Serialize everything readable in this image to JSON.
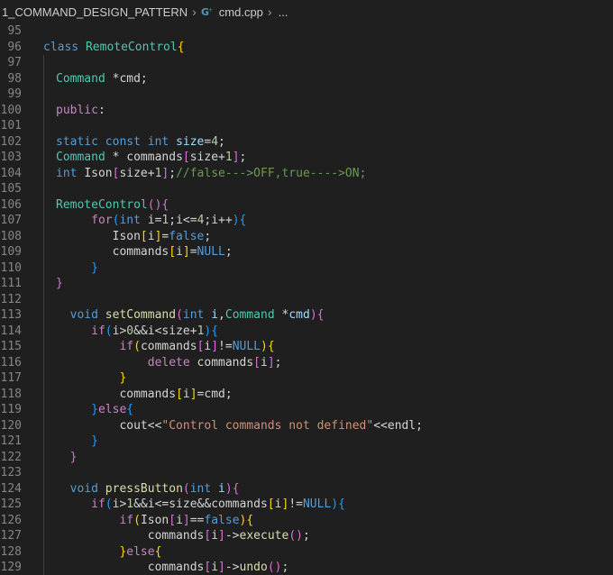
{
  "breadcrumb": {
    "folder": "1_COMMAND_DESIGN_PATTERN",
    "file": "cmd.cpp",
    "more": "..."
  },
  "editor": {
    "language": "cpp",
    "theme_colors": {
      "background": "#1f1f1f",
      "line_number": "#858585",
      "keyword": "#569cd6",
      "control": "#c586c0",
      "type": "#4ec9b0",
      "function": "#dcdcaa",
      "variable": "#9cdcfe",
      "number": "#b5cea8",
      "string": "#ce9178",
      "comment": "#6a9955"
    },
    "lines": [
      {
        "n": "95",
        "indent": 0,
        "tokens": []
      },
      {
        "n": "96",
        "indent": 0,
        "tokens": [
          [
            "k",
            "class "
          ],
          [
            "t",
            "RemoteControl"
          ],
          [
            "b1",
            "{"
          ]
        ]
      },
      {
        "n": "97",
        "indent": 1,
        "tokens": []
      },
      {
        "n": "98",
        "indent": 1,
        "tokens": [
          [
            "t",
            "Command"
          ],
          [
            "p",
            " *cmd;"
          ]
        ]
      },
      {
        "n": "99",
        "indent": 1,
        "tokens": []
      },
      {
        "n": "100",
        "indent": 1,
        "tokens": [
          [
            "c",
            "public"
          ],
          [
            "p",
            ":"
          ]
        ]
      },
      {
        "n": "101",
        "indent": 1,
        "tokens": []
      },
      {
        "n": "102",
        "indent": 1,
        "tokens": [
          [
            "k",
            "static "
          ],
          [
            "k",
            "const "
          ],
          [
            "k",
            "int "
          ],
          [
            "v",
            "size"
          ],
          [
            "p",
            "="
          ],
          [
            "n",
            "4"
          ],
          [
            "p",
            ";"
          ]
        ]
      },
      {
        "n": "103",
        "indent": 1,
        "tokens": [
          [
            "t",
            "Command"
          ],
          [
            "p",
            " * commands"
          ],
          [
            "b2",
            "["
          ],
          [
            "p",
            "size+"
          ],
          [
            "n",
            "1"
          ],
          [
            "b2",
            "]"
          ],
          [
            "p",
            ";"
          ]
        ]
      },
      {
        "n": "104",
        "indent": 1,
        "tokens": [
          [
            "k",
            "int "
          ],
          [
            "p",
            "Ison"
          ],
          [
            "b2",
            "["
          ],
          [
            "p",
            "size+"
          ],
          [
            "n",
            "1"
          ],
          [
            "b2",
            "]"
          ],
          [
            "p",
            ";"
          ],
          [
            "cm",
            "//false--->OFF,true---->ON;"
          ]
        ]
      },
      {
        "n": "105",
        "indent": 1,
        "tokens": []
      },
      {
        "n": "106",
        "indent": 1,
        "tokens": [
          [
            "t",
            "RemoteControl"
          ],
          [
            "b2",
            "()"
          ],
          [
            "b2",
            "{"
          ]
        ]
      },
      {
        "n": "107",
        "indent": 1,
        "tokens": [
          [
            "p",
            "     "
          ],
          [
            "c",
            "for"
          ],
          [
            "b3",
            "("
          ],
          [
            "k",
            "int "
          ],
          [
            "p",
            "i="
          ],
          [
            "n",
            "1"
          ],
          [
            "p",
            ";i<="
          ],
          [
            "n",
            "4"
          ],
          [
            "p",
            ";i++"
          ],
          [
            "b3",
            ")"
          ],
          [
            "b3",
            "{"
          ]
        ]
      },
      {
        "n": "108",
        "indent": 1,
        "tokens": [
          [
            "p",
            "        Ison"
          ],
          [
            "b1",
            "["
          ],
          [
            "p",
            "i"
          ],
          [
            "b1",
            "]"
          ],
          [
            "p",
            "="
          ],
          [
            "k",
            "false"
          ],
          [
            "p",
            ";"
          ]
        ]
      },
      {
        "n": "109",
        "indent": 1,
        "tokens": [
          [
            "p",
            "        commands"
          ],
          [
            "b1",
            "["
          ],
          [
            "p",
            "i"
          ],
          [
            "b1",
            "]"
          ],
          [
            "p",
            "="
          ],
          [
            "k",
            "NULL"
          ],
          [
            "p",
            ";"
          ]
        ]
      },
      {
        "n": "110",
        "indent": 1,
        "tokens": [
          [
            "p",
            "     "
          ],
          [
            "b3",
            "}"
          ]
        ]
      },
      {
        "n": "111",
        "indent": 1,
        "tokens": [
          [
            "b2",
            "}"
          ]
        ]
      },
      {
        "n": "112",
        "indent": 1,
        "tokens": []
      },
      {
        "n": "113",
        "indent": 1,
        "tokens": [
          [
            "p",
            "  "
          ],
          [
            "k",
            "void "
          ],
          [
            "f",
            "setCommand"
          ],
          [
            "b2",
            "("
          ],
          [
            "k",
            "int "
          ],
          [
            "v",
            "i"
          ],
          [
            "p",
            ","
          ],
          [
            "t",
            "Command "
          ],
          [
            "p",
            "*"
          ],
          [
            "v",
            "cmd"
          ],
          [
            "b2",
            ")"
          ],
          [
            "b2",
            "{"
          ]
        ]
      },
      {
        "n": "114",
        "indent": 1,
        "tokens": [
          [
            "p",
            "     "
          ],
          [
            "c",
            "if"
          ],
          [
            "b3",
            "("
          ],
          [
            "p",
            "i>"
          ],
          [
            "n",
            "0"
          ],
          [
            "p",
            "&&i<size+"
          ],
          [
            "n",
            "1"
          ],
          [
            "b3",
            ")"
          ],
          [
            "b3",
            "{"
          ]
        ]
      },
      {
        "n": "115",
        "indent": 1,
        "tokens": [
          [
            "p",
            "         "
          ],
          [
            "c",
            "if"
          ],
          [
            "b1",
            "("
          ],
          [
            "p",
            "commands"
          ],
          [
            "b2",
            "["
          ],
          [
            "p",
            "i"
          ],
          [
            "b2",
            "]"
          ],
          [
            "p",
            "!="
          ],
          [
            "k",
            "NULL"
          ],
          [
            "b1",
            ")"
          ],
          [
            "b1",
            "{"
          ]
        ]
      },
      {
        "n": "116",
        "indent": 1,
        "tokens": [
          [
            "p",
            "             "
          ],
          [
            "c",
            "delete "
          ],
          [
            "p",
            "commands"
          ],
          [
            "b2",
            "["
          ],
          [
            "p",
            "i"
          ],
          [
            "b2",
            "]"
          ],
          [
            "p",
            ";"
          ]
        ]
      },
      {
        "n": "117",
        "indent": 1,
        "tokens": [
          [
            "p",
            "         "
          ],
          [
            "b1",
            "}"
          ]
        ]
      },
      {
        "n": "118",
        "indent": 1,
        "tokens": [
          [
            "p",
            "         commands"
          ],
          [
            "b1",
            "["
          ],
          [
            "p",
            "i"
          ],
          [
            "b1",
            "]"
          ],
          [
            "p",
            "=cmd;"
          ]
        ]
      },
      {
        "n": "119",
        "indent": 1,
        "tokens": [
          [
            "p",
            "     "
          ],
          [
            "b3",
            "}"
          ],
          [
            "c",
            "else"
          ],
          [
            "b3",
            "{"
          ]
        ]
      },
      {
        "n": "120",
        "indent": 1,
        "tokens": [
          [
            "p",
            "         cout<<"
          ],
          [
            "s",
            "\"Control commands not defined\""
          ],
          [
            "p",
            "<<endl;"
          ]
        ]
      },
      {
        "n": "121",
        "indent": 1,
        "tokens": [
          [
            "p",
            "     "
          ],
          [
            "b3",
            "}"
          ]
        ]
      },
      {
        "n": "122",
        "indent": 1,
        "tokens": [
          [
            "p",
            "  "
          ],
          [
            "b2",
            "}"
          ]
        ]
      },
      {
        "n": "123",
        "indent": 1,
        "tokens": []
      },
      {
        "n": "124",
        "indent": 1,
        "tokens": [
          [
            "p",
            "  "
          ],
          [
            "k",
            "void "
          ],
          [
            "f",
            "pressButton"
          ],
          [
            "b2",
            "("
          ],
          [
            "k",
            "int "
          ],
          [
            "v",
            "i"
          ],
          [
            "b2",
            ")"
          ],
          [
            "b2",
            "{"
          ]
        ]
      },
      {
        "n": "125",
        "indent": 1,
        "tokens": [
          [
            "p",
            "     "
          ],
          [
            "c",
            "if"
          ],
          [
            "b3",
            "("
          ],
          [
            "p",
            "i>"
          ],
          [
            "n",
            "1"
          ],
          [
            "p",
            "&&i<=size&&commands"
          ],
          [
            "b1",
            "["
          ],
          [
            "p",
            "i"
          ],
          [
            "b1",
            "]"
          ],
          [
            "p",
            "!="
          ],
          [
            "k",
            "NULL"
          ],
          [
            "b3",
            ")"
          ],
          [
            "b3",
            "{"
          ]
        ]
      },
      {
        "n": "126",
        "indent": 1,
        "tokens": [
          [
            "p",
            "         "
          ],
          [
            "c",
            "if"
          ],
          [
            "b1",
            "("
          ],
          [
            "p",
            "Ison"
          ],
          [
            "b2",
            "["
          ],
          [
            "p",
            "i"
          ],
          [
            "b2",
            "]"
          ],
          [
            "p",
            "=="
          ],
          [
            "k",
            "false"
          ],
          [
            "b1",
            ")"
          ],
          [
            "b1",
            "{"
          ]
        ]
      },
      {
        "n": "127",
        "indent": 1,
        "tokens": [
          [
            "p",
            "             commands"
          ],
          [
            "b2",
            "["
          ],
          [
            "p",
            "i"
          ],
          [
            "b2",
            "]"
          ],
          [
            "p",
            "->"
          ],
          [
            "f",
            "execute"
          ],
          [
            "b2",
            "()"
          ],
          [
            "p",
            ";"
          ]
        ]
      },
      {
        "n": "128",
        "indent": 1,
        "tokens": [
          [
            "p",
            "         "
          ],
          [
            "b1",
            "}"
          ],
          [
            "c",
            "else"
          ],
          [
            "b1",
            "{"
          ]
        ]
      },
      {
        "n": "129",
        "indent": 1,
        "tokens": [
          [
            "p",
            "             commands"
          ],
          [
            "b2",
            "["
          ],
          [
            "p",
            "i"
          ],
          [
            "b2",
            "]"
          ],
          [
            "p",
            "->"
          ],
          [
            "f",
            "undo"
          ],
          [
            "b2",
            "()"
          ],
          [
            "p",
            ";"
          ]
        ]
      }
    ]
  }
}
